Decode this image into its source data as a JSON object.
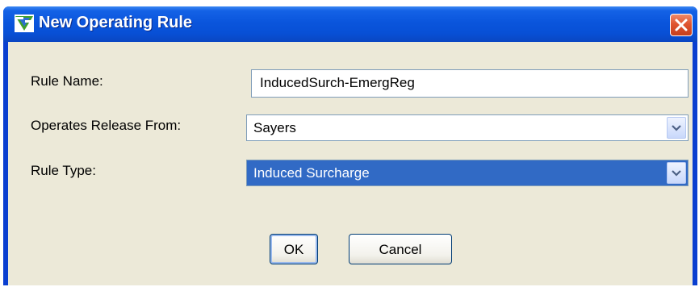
{
  "window": {
    "title": "New Operating Rule",
    "icon": "app-icon",
    "close_icon": "close-icon"
  },
  "form": {
    "rule_name_label": "Rule Name:",
    "rule_name_value": "InducedSurch-EmergReg",
    "release_label": "Operates Release From:",
    "release_value": "Sayers",
    "rule_type_label": "Rule Type:",
    "rule_type_value": "Induced Surcharge"
  },
  "buttons": {
    "ok_label": "OK",
    "cancel_label": "Cancel"
  },
  "colors": {
    "title_bar": "#0a55dc",
    "dialog_background": "#ece9d8",
    "selection": "#316ac5"
  }
}
